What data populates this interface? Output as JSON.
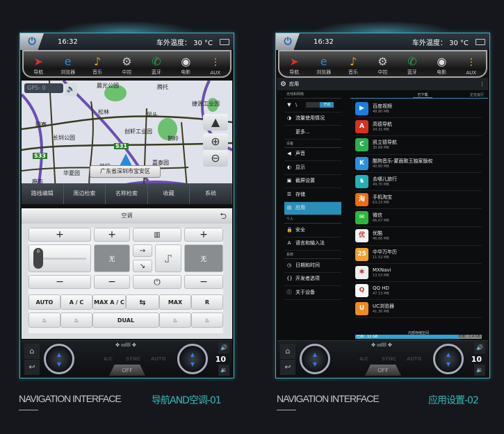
{
  "status": {
    "time": "16:32",
    "temperature": "车外温度： 30 °C"
  },
  "dock": [
    {
      "label": "导航",
      "icon": "navigation-arrow",
      "color": "#d8302a",
      "glyph": "➤"
    },
    {
      "label": "浏览器",
      "icon": "browser-e",
      "color": "#2d8bd8",
      "glyph": "e"
    },
    {
      "label": "音乐",
      "icon": "music-note",
      "color": "#e8a020",
      "glyph": "♪"
    },
    {
      "label": "中控",
      "icon": "steering-seat",
      "color": "#ccc",
      "glyph": "⚙"
    },
    {
      "label": "蓝牙",
      "icon": "phone-handset",
      "color": "#2aa050",
      "glyph": "✆"
    },
    {
      "label": "电影",
      "icon": "film-reel",
      "color": "#ddd",
      "glyph": "◉"
    },
    {
      "label": "AUX",
      "icon": "rca-plugs",
      "color": "#e8c020",
      "glyph": "⫶"
    }
  ],
  "map": {
    "gps": "GPS-  0",
    "address": "广东省深圳市宝安区",
    "labels": [
      "晨光公园",
      "腾托",
      "捷源工业园",
      "松林",
      "田寮",
      "长圳公园",
      "创轩工业园",
      "凤头",
      "鹅岭",
      "S31",
      "S33",
      "甘坑",
      "华夏园",
      "嘉泰园",
      "麻布"
    ],
    "menu": [
      "路线编辑",
      "周边检索",
      "名称检索",
      "收藏",
      "系统"
    ]
  },
  "ac": {
    "title": "空调",
    "plus": "+",
    "minus": "−",
    "fan_level": "0",
    "left_temp": "无",
    "right_temp": "无",
    "row1": [
      "AUTO",
      "A / C",
      "MAX A / C",
      "",
      "MAX",
      "R"
    ],
    "dual": "DUAL"
  },
  "bottom": {
    "labels": [
      "A/C",
      "SYNC",
      "AUTO"
    ],
    "off": "OFF",
    "volume": "10"
  },
  "settings": {
    "title": "应用",
    "sections": {
      "wireless": "无线和网络",
      "device": "设备",
      "personal": "个人",
      "system": "系统"
    },
    "toggle": "开启",
    "items": {
      "data": "流量使用情况",
      "more": "更多...",
      "sound": "声音",
      "display": "显示",
      "screenshot": "截屏设置",
      "storage": "存储",
      "apps": "应用",
      "security": "安全",
      "language": "语言和输入法",
      "datetime": "日期和时间",
      "dev": "开发者选项",
      "about": "关于设备"
    },
    "tabs": [
      "已下载",
      "正在运行"
    ],
    "apps": [
      {
        "name": "百度视频",
        "size": "48.80 MB",
        "color": "#1a7fe0",
        "glyph": "▶"
      },
      {
        "name": "高德导航",
        "size": "34.31 MB",
        "color": "#d83020",
        "glyph": "A"
      },
      {
        "name": "凯立德导航",
        "size": "30.88 MB",
        "color": "#2ab050",
        "glyph": "C"
      },
      {
        "name": "酷狗音乐-蒙面歌王独家版权",
        "size": "40.80 MB",
        "color": "#2a90e0",
        "glyph": "K"
      },
      {
        "name": "去哪儿旅行",
        "size": "49.70 MB",
        "color": "#20b0b8",
        "glyph": "♞"
      },
      {
        "name": "手机淘宝",
        "size": "63.23 MB",
        "color": "#f06a10",
        "glyph": "淘"
      },
      {
        "name": "微信",
        "size": "66.07 MB",
        "color": "#2ab83a",
        "glyph": "✉"
      },
      {
        "name": "优酷",
        "size": "46.66 MB",
        "color": "#f4f4f4",
        "glyph": "优"
      },
      {
        "name": "中华万年历",
        "size": "11.52 MB",
        "color": "#f0a030",
        "glyph": "25"
      },
      {
        "name": "MXNavi",
        "size": "13.53 MB",
        "color": "#eeeeee",
        "glyph": "✱"
      },
      {
        "name": "QQ HD",
        "size": "47.13 MB",
        "color": "#f8f8f8",
        "glyph": "Q"
      },
      {
        "name": "UC浏览器",
        "size": "41.36 MB",
        "color": "#f08a20",
        "glyph": "U"
      }
    ],
    "storage": {
      "label": "内部存储空间",
      "used": "已用：11 GB",
      "free": "可用：2.4 GB",
      "used_fraction": 0.82
    }
  },
  "captions": {
    "left_en": "NAVIGATION INTERFACE",
    "left_cn": "导航AND空调-01",
    "right_en": "NAVIGATION INTERFACE",
    "right_cn": "应用设置-02"
  },
  "colors": {
    "accent": "#3fb6c4",
    "caption_cn": "#35b8b8",
    "active": "#2a8fb8"
  }
}
